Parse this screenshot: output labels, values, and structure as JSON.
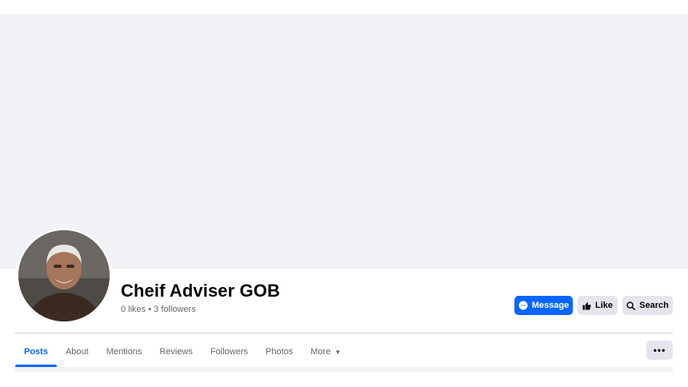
{
  "page": {
    "name": "Cheif Adviser GOB",
    "stats": "0 likes • 3 followers"
  },
  "actions": {
    "message_label": "Message",
    "like_label": "Like",
    "search_label": "Search"
  },
  "tabs": [
    {
      "label": "Posts",
      "active": true
    },
    {
      "label": "About"
    },
    {
      "label": "Mentions"
    },
    {
      "label": "Reviews"
    },
    {
      "label": "Followers"
    },
    {
      "label": "Photos"
    },
    {
      "label": "More"
    }
  ],
  "more_button_label": "•••",
  "colors": {
    "accent": "#0866ff",
    "cover": "#f0f2f5",
    "secondary_button": "#e4e6eb",
    "muted_text": "#65676b"
  },
  "icons": {
    "message": "messenger-icon",
    "like": "thumbs-up-icon",
    "search": "search-icon",
    "more_tab": "caret-down-icon"
  }
}
